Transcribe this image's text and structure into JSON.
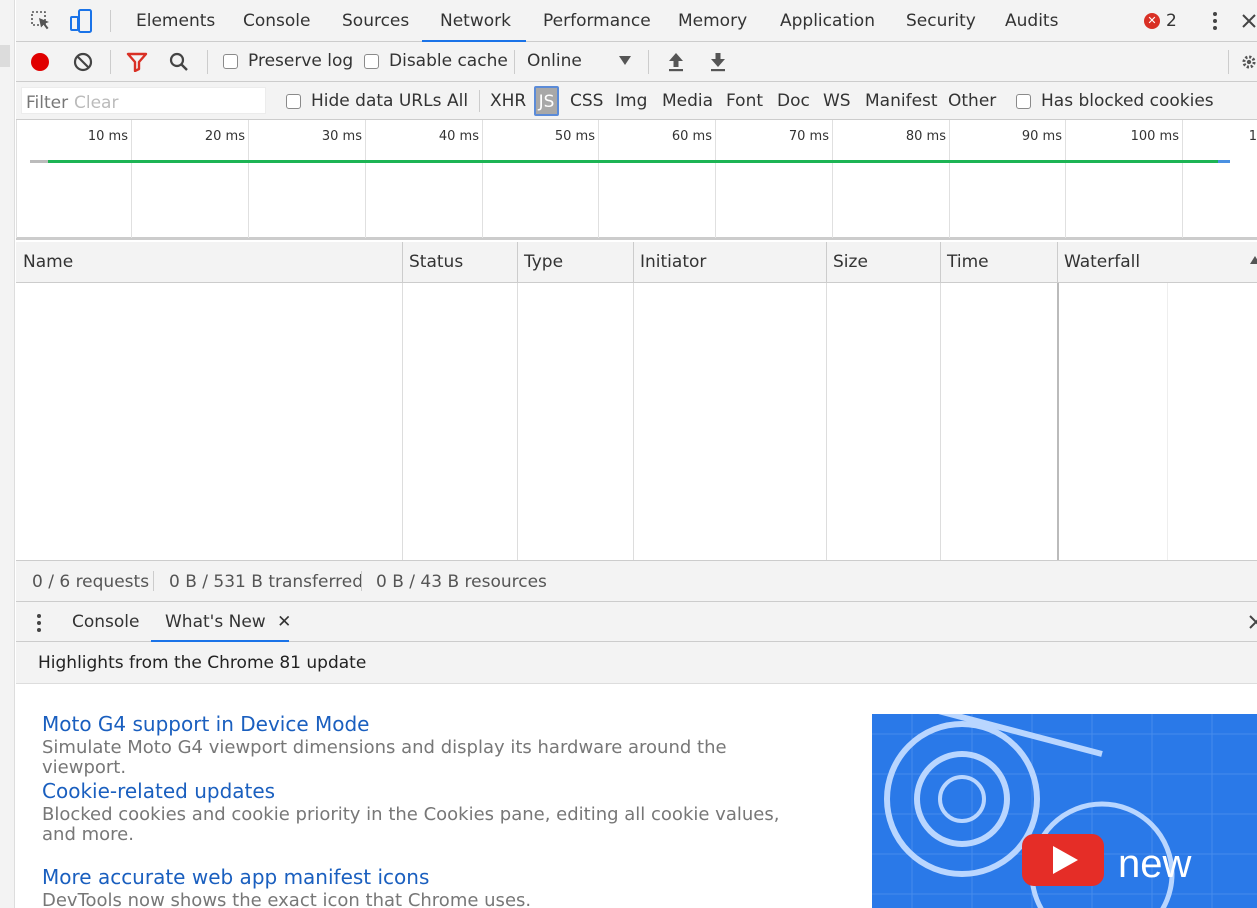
{
  "tabs": [
    {
      "label": "Elements",
      "active": false
    },
    {
      "label": "Console",
      "active": false
    },
    {
      "label": "Sources",
      "active": false
    },
    {
      "label": "Network",
      "active": true
    },
    {
      "label": "Performance",
      "active": false
    },
    {
      "label": "Memory",
      "active": false
    },
    {
      "label": "Application",
      "active": false
    },
    {
      "label": "Security",
      "active": false
    },
    {
      "label": "Audits",
      "active": false
    }
  ],
  "error_count": "2",
  "toolbar": {
    "preserve_log": "Preserve log",
    "disable_cache": "Disable cache",
    "throttling": "Online"
  },
  "filter": {
    "placeholder": "Filter",
    "clear": "Clear",
    "hide_data_urls": "Hide data URLs",
    "types": [
      "All",
      "XHR",
      "JS",
      "CSS",
      "Img",
      "Media",
      "Font",
      "Doc",
      "WS",
      "Manifest",
      "Other"
    ],
    "selected_type": "JS",
    "has_blocked_cookies": "Has blocked cookies"
  },
  "timeline": {
    "ticks": [
      "10 ms",
      "20 ms",
      "30 ms",
      "40 ms",
      "50 ms",
      "60 ms",
      "70 ms",
      "80 ms",
      "90 ms",
      "100 ms",
      "1"
    ]
  },
  "table": {
    "columns": [
      "Name",
      "Status",
      "Type",
      "Initiator",
      "Size",
      "Time",
      "Waterfall"
    ]
  },
  "status": {
    "requests": "0 / 6 requests",
    "transferred": "0 B / 531 B transferred",
    "resources": "0 B / 43 B resources"
  },
  "drawer": {
    "tabs": [
      "Console",
      "What's New"
    ],
    "active_tab": "What's New",
    "header": "Highlights from the Chrome 81 update",
    "features": [
      {
        "title": "Moto G4 support in Device Mode",
        "desc": "Simulate Moto G4 viewport dimensions and display its hardware around the viewport."
      },
      {
        "title": "Cookie-related updates",
        "desc": "Blocked cookies and cookie priority in the Cookies pane, editing all cookie values, and more."
      },
      {
        "title": "More accurate web app manifest icons",
        "desc": "DevTools now shows the exact icon that Chrome uses."
      }
    ],
    "promo_text": "new"
  },
  "colors": {
    "accent": "#1a73e8",
    "record": "#e00000",
    "filter_icon": "#d93025",
    "timeline_bar": "#1db454",
    "link": "#1a5fbf",
    "promo_bg": "#2a79e8"
  }
}
